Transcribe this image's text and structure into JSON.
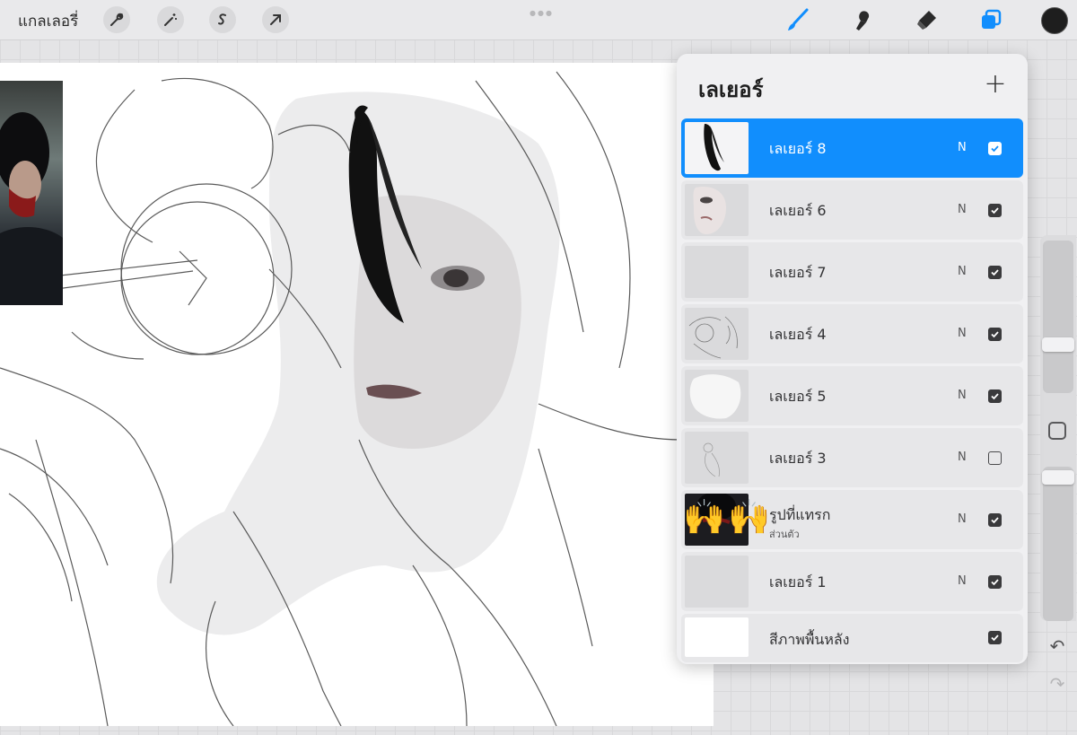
{
  "topbar": {
    "gallery_label": "แกลเลอรี่",
    "tools_left": [
      {
        "icon": "wrench-icon",
        "name": "actions"
      },
      {
        "icon": "magic-wand-icon",
        "name": "adjustments"
      },
      {
        "icon": "selection-icon",
        "name": "selection"
      },
      {
        "icon": "arrow-cursor-icon",
        "name": "transform"
      }
    ],
    "tools_right": [
      {
        "icon": "brush-icon",
        "name": "paint",
        "active": true
      },
      {
        "icon": "smudge-icon",
        "name": "smudge"
      },
      {
        "icon": "eraser-icon",
        "name": "eraser"
      },
      {
        "icon": "layers-icon",
        "name": "layers",
        "active": true
      }
    ],
    "current_color": "#1e1e1e",
    "accent_color": "#118efd"
  },
  "layers_panel": {
    "title": "เลเยอร์",
    "add_icon": "plus-icon",
    "layers": [
      {
        "name": "เลเยอร์ 8",
        "blend": "N",
        "visible": true,
        "selected": true
      },
      {
        "name": "เลเยอร์ 6",
        "blend": "N",
        "visible": true
      },
      {
        "name": "เลเยอร์ 7",
        "blend": "N",
        "visible": true
      },
      {
        "name": "เลเยอร์ 4",
        "blend": "N",
        "visible": true
      },
      {
        "name": "เลเยอร์ 5",
        "blend": "N",
        "visible": true
      },
      {
        "name": "เลเยอร์ 3",
        "blend": "N",
        "visible": false
      },
      {
        "name": "รูปที่แทรก",
        "sub": "ส่วนตัว",
        "blend": "N",
        "visible": true
      },
      {
        "name": "เลเยอร์ 1",
        "blend": "N",
        "visible": true
      },
      {
        "name": "สีภาพพื้นหลัง",
        "blend": "",
        "visible": true
      }
    ],
    "emoji": "🙌"
  },
  "sidebar": {
    "undo_icon": "undo-icon",
    "redo_icon": "redo-icon",
    "modify_icon": "square-icon"
  }
}
